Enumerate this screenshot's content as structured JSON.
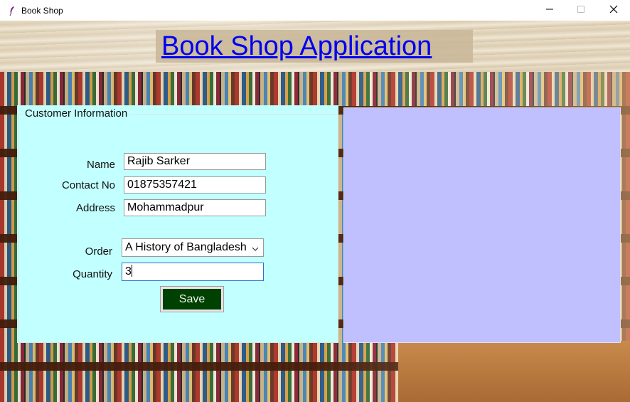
{
  "window": {
    "title": "Book Shop",
    "icons": {
      "app": "feather-icon",
      "minimize": "minimize-icon",
      "maximize": "maximize-icon",
      "close": "close-icon"
    }
  },
  "header": {
    "title": "Book Shop Application"
  },
  "customer": {
    "legend": "Customer Information",
    "name_label": "Name",
    "name_value": "Rajib Sarker",
    "contact_label": "Contact No",
    "contact_value": "01875357421",
    "address_label": "Address",
    "address_value": "Mohammadpur",
    "order_label": "Order",
    "order_value": "A History of Bangladesh",
    "quantity_label": "Quantity",
    "quantity_value": "3",
    "save_label": "Save"
  },
  "colors": {
    "panel_bg": "#c2ffff",
    "right_panel_bg": "#c0c0ff",
    "save_bg": "#004000",
    "heading": "#0000ee"
  }
}
